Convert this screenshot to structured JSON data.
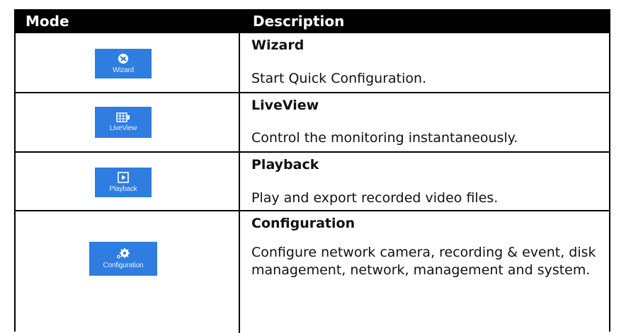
{
  "header": {
    "mode": "Mode",
    "description": "Description"
  },
  "rows": [
    {
      "icon": "wizard-icon",
      "tile_label": "Wizard",
      "title": "Wizard",
      "text": "Start Quick Configuration."
    },
    {
      "icon": "liveview-icon",
      "tile_label": "LiveView",
      "title": "LiveView",
      "text": "Control the monitoring instantaneously."
    },
    {
      "icon": "playback-icon",
      "tile_label": "Playback",
      "title": "Playback",
      "text": "Play and export recorded video files."
    },
    {
      "icon": "configuration-icon",
      "tile_label": "Configuration",
      "title": "Configuration",
      "text": "Configure network camera, recording & event, disk management, network, management and system."
    }
  ],
  "colors": {
    "tile": "#2f7de0",
    "header_bg": "#000000",
    "header_text": "#ffffff"
  }
}
